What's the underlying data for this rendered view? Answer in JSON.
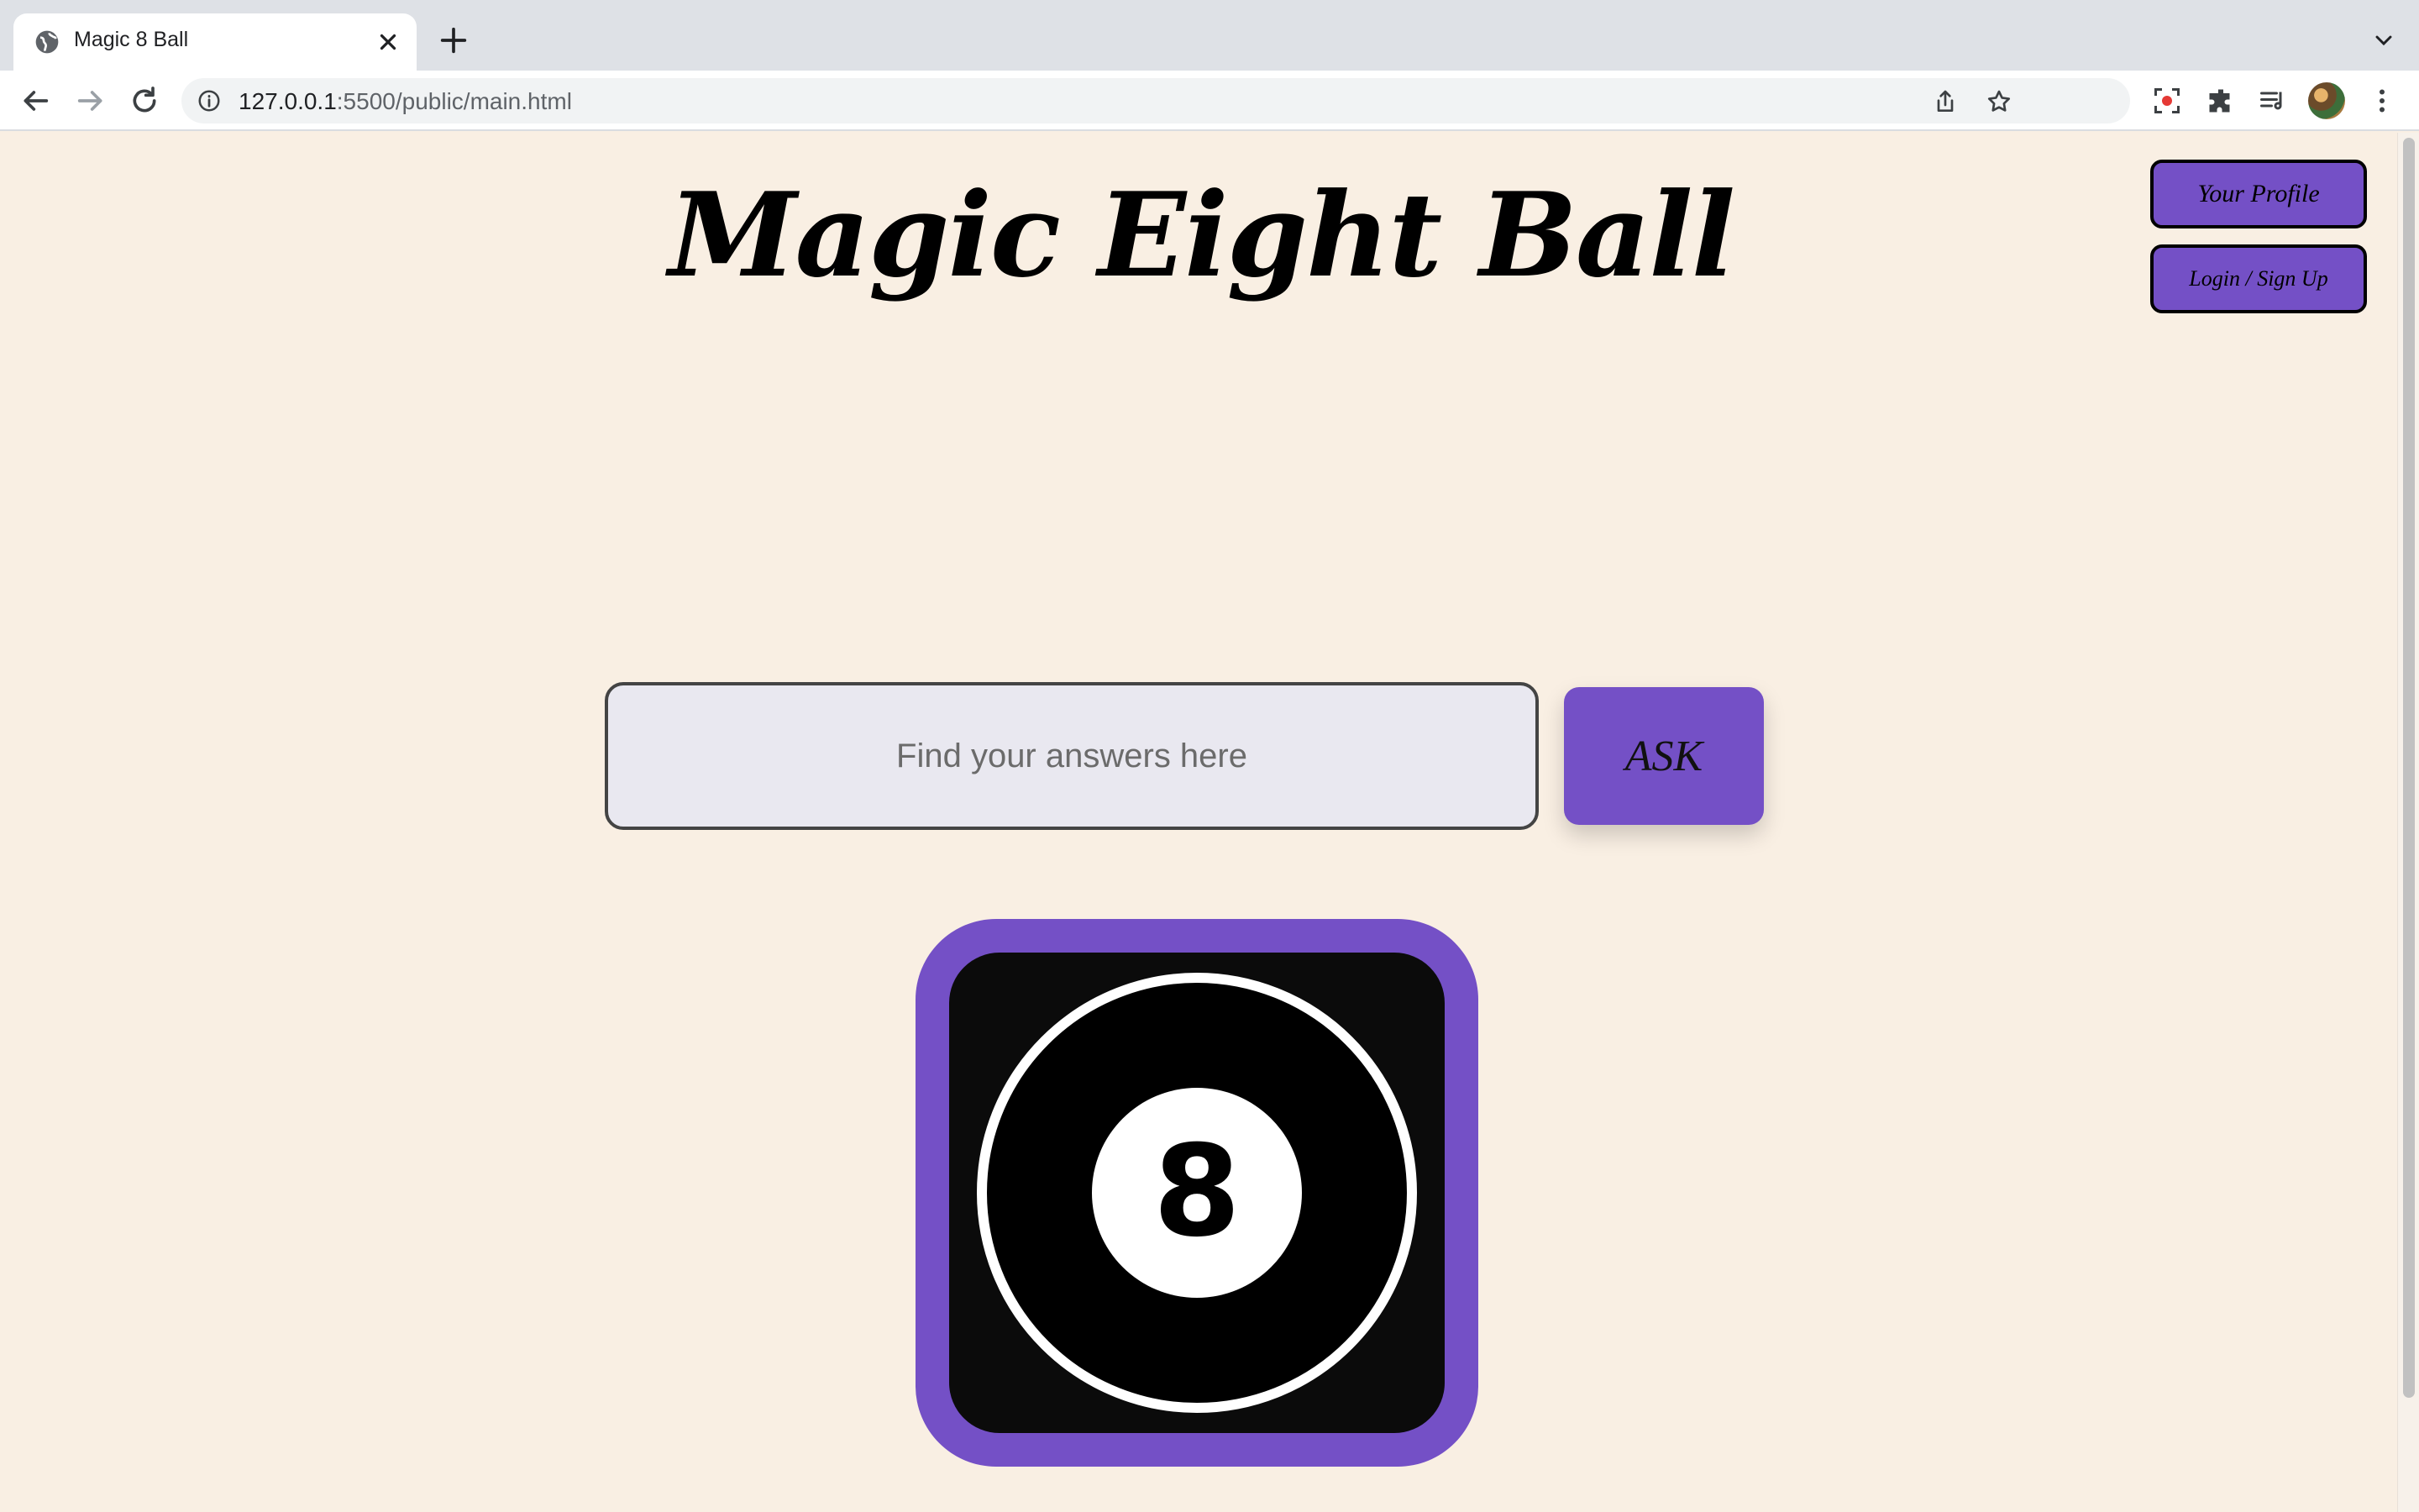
{
  "browser": {
    "tab_title": "Magic 8 Ball",
    "url_host": "127.0.0.1",
    "url_rest": ":5500/public/main.html",
    "icons": [
      "globe-icon",
      "close-icon",
      "plus-icon",
      "chevron-down-icon",
      "back-arrow-icon",
      "forward-arrow-icon",
      "reload-icon",
      "info-icon",
      "share-icon",
      "star-icon",
      "screen-capture-icon",
      "puzzle-icon",
      "reading-list-icon",
      "avatar",
      "more-vert-icon"
    ]
  },
  "page": {
    "title": "Magic Eight Ball",
    "profile_button": "Your Profile",
    "login_button": "Login / Sign Up",
    "question_placeholder": "Find your answers here",
    "question_value": "",
    "ask_button": "ASK",
    "ball_number": "8"
  },
  "colors": {
    "background": "#f9efe3",
    "accent_purple": "#7450c6",
    "input_bg": "#e9e8f0"
  }
}
